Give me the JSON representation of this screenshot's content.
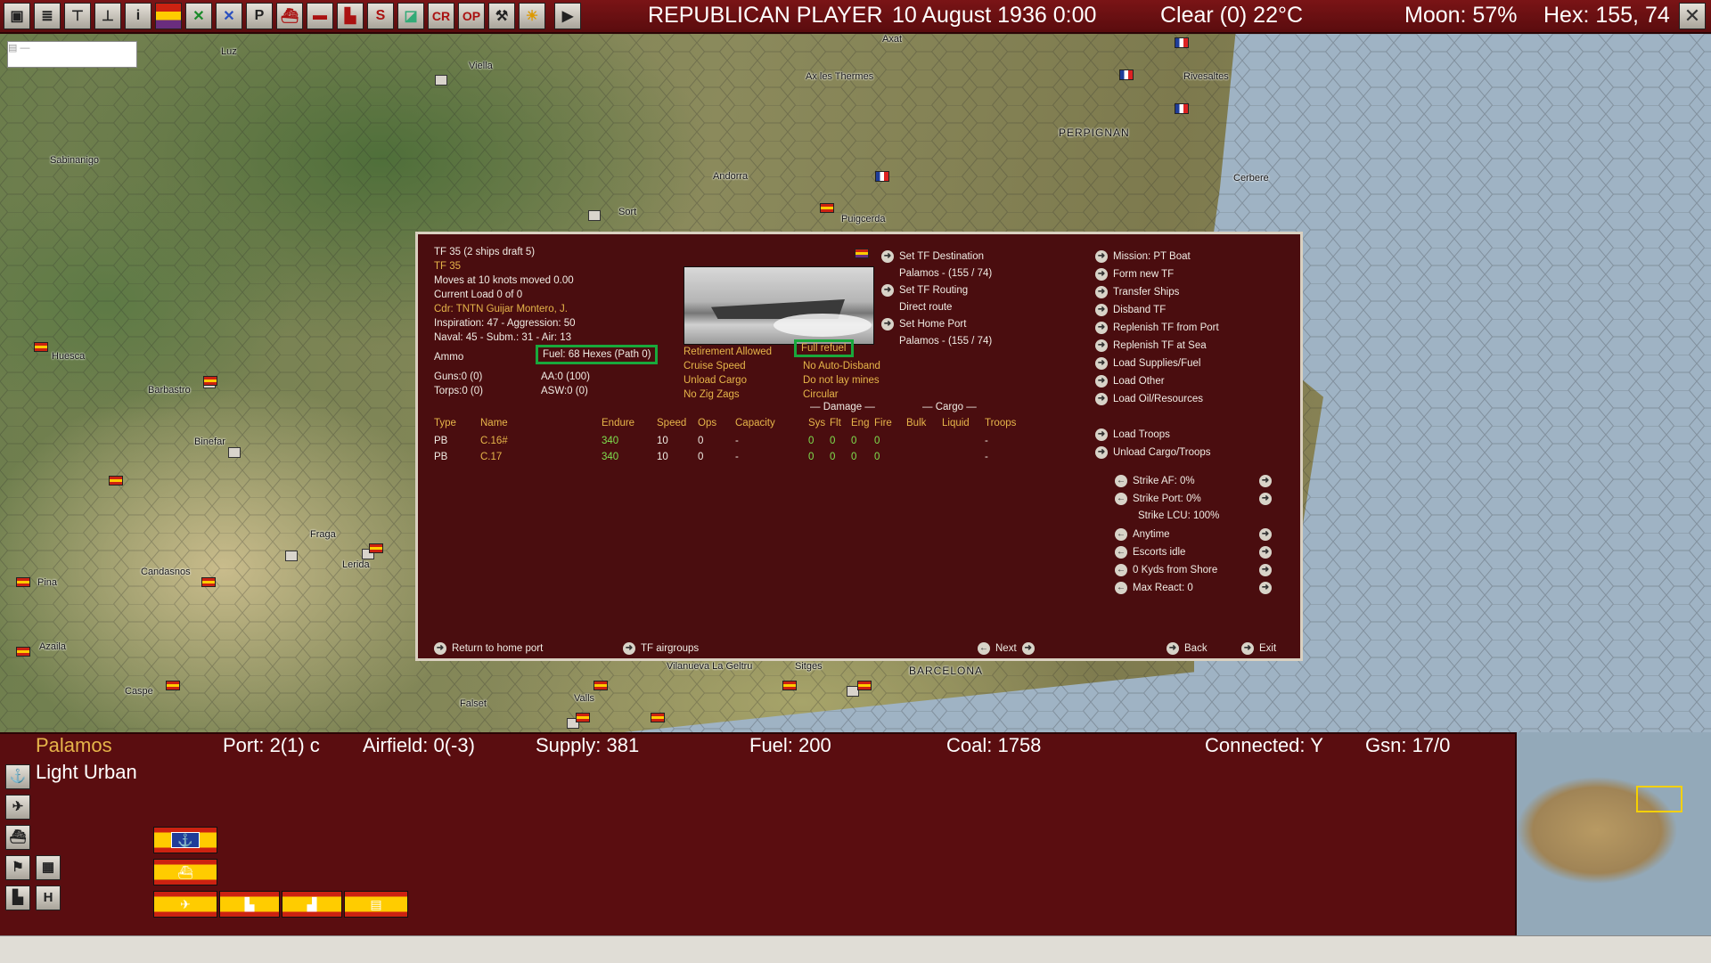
{
  "topbar": {
    "icons": [
      "save-icon",
      "report-icon",
      "tree-icon",
      "tree-alt-icon",
      "info-icon",
      "flag-icon",
      "cross-swords-green-icon",
      "cross-swords-blue-icon",
      "p-icon",
      "ship-icon",
      "sub-icon",
      "factory-icon",
      "s-icon",
      "map-icon",
      "cr-icon",
      "op-icon",
      "wrench-icon",
      "weather-icon"
    ],
    "cr_label": "CR",
    "op_label": "OP",
    "s_label": "S",
    "p_label": "P",
    "player": "REPUBLICAN PLAYER",
    "date": "10 August 1936 0:00",
    "weather": "Clear (0) 22°C",
    "moon": "Moon: 57%",
    "hex": "Hex: 155, 74"
  },
  "map": {
    "labels": [
      "Luz",
      "Viella",
      "Axat",
      "Ax les Thermes",
      "Rivesaltes",
      "Sabinanigo",
      "Andorra",
      "PERPIGNAN",
      "Cerbere",
      "Sort",
      "Puigcerda",
      "Huesca",
      "Barbastro",
      "Binefar",
      "Fraga",
      "Lerida",
      "Candasnos",
      "Pina",
      "Azaila",
      "Caspe",
      "Vilanueva La Geltru",
      "Sitges",
      "BARCELONA",
      "Valls",
      "Falset"
    ]
  },
  "dialog": {
    "tf_title": "TF 35 (2 ships draft 5)",
    "tf_name": "TF 35",
    "moves": "Moves at 10 knots moved 0.00",
    "load": "Current Load 0 of 0",
    "cdr": "Cdr: TNTN Guijar Montero, J.",
    "inspiration": "Inspiration: 47 - Aggression: 50",
    "naval": "Naval: 45 - Subm.: 31 - Air: 13",
    "ammo": "Ammo",
    "fuel": "Fuel: 68 Hexes (Path 0)",
    "guns": "Guns:0 (0)",
    "aa": "AA:0 (100)",
    "torps": "Torps:0 (0)",
    "asw": "ASW:0 (0)",
    "opts_left": [
      "Retirement Allowed",
      "Cruise Speed",
      "Unload Cargo",
      "No Zig Zags"
    ],
    "opts_right": [
      "Full refuel",
      "No Auto-Disband",
      "Do not lay mines",
      "Circular"
    ],
    "mid_actions": [
      {
        "label": "Set TF Destination",
        "arrow": true
      },
      {
        "label": "Palamos - (155 / 74)",
        "arrow": false
      },
      {
        "label": "Set TF Routing",
        "arrow": true
      },
      {
        "label": "Direct route",
        "arrow": false
      },
      {
        "label": "Set Home Port",
        "arrow": true
      },
      {
        "label": "Palamos - (155 / 74)",
        "arrow": false
      }
    ],
    "right_actions": [
      "Mission: PT Boat",
      "Form new TF",
      "Transfer Ships",
      "Disband TF",
      "Replenish TF from Port",
      "Replenish TF at Sea",
      "Load Supplies/Fuel",
      "Load Other",
      "Load Oil/Resources"
    ],
    "troop_actions": [
      "Load Troops",
      "Unload Cargo/Troops"
    ],
    "strike_opts": [
      {
        "label": "Strike AF: 0%",
        "arrows": true
      },
      {
        "label": "Strike Port: 0%",
        "arrows": true
      },
      {
        "label": "Strike LCU: 100%",
        "arrows": false
      },
      {
        "label": "Anytime",
        "arrows": true
      },
      {
        "label": "Escorts idle",
        "arrows": true
      },
      {
        "label": "0 Kyds from Shore",
        "arrows": true
      },
      {
        "label": "Max React: 0",
        "arrows": true
      }
    ],
    "damage_header": "Damage",
    "cargo_header": "Cargo",
    "columns": [
      "Type",
      "Name",
      "Endure",
      "Speed",
      "Ops",
      "Capacity",
      "Sys",
      "Flt",
      "Eng",
      "Fire",
      "Bulk",
      "Liquid",
      "Troops"
    ],
    "rows": [
      [
        "PB",
        "C.16#",
        "340",
        "10",
        "0",
        "-",
        "0",
        "0",
        "0",
        "0",
        "",
        "",
        "-"
      ],
      [
        "PB",
        "C.17",
        "340",
        "10",
        "0",
        "-",
        "0",
        "0",
        "0",
        "0",
        "",
        "",
        "-"
      ]
    ],
    "footer": {
      "return": "Return to home port",
      "airgroups": "TF airgroups",
      "next": "Next",
      "back": "Back",
      "exit": "Exit"
    }
  },
  "bottom": {
    "location": "Palamos",
    "terrain": "Light Urban",
    "port": "Port: 2(1) c",
    "airfield": "Airfield: 0(-3)",
    "supply": "Supply: 381",
    "fuel": "Fuel: 200",
    "coal": "Coal: 1758",
    "connected": "Connected: Y",
    "gsn": "Gsn: 17/0",
    "side_icons": [
      "anchor-icon",
      "plane-icon",
      "ship-icon",
      "flag-icon",
      "map-icon",
      "factory-icon",
      "h-icon"
    ],
    "h_label": "H"
  },
  "colors": {
    "accent": "#5a0d10",
    "gold": "#e6b54a",
    "green": "#7ee04f",
    "highlight": "#19a83c"
  }
}
